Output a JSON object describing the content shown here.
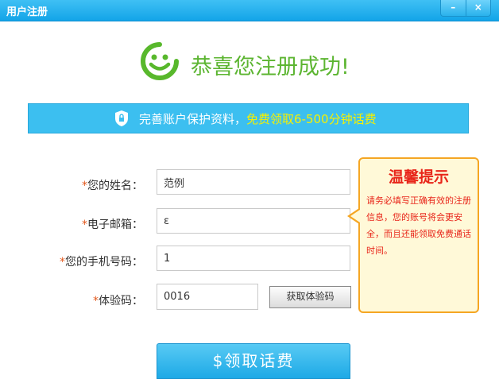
{
  "window": {
    "title": "用户注册",
    "minimize": "–",
    "close": "×"
  },
  "success": {
    "message": "恭喜您注册成功!"
  },
  "banner": {
    "text": "完善账户保护资料，",
    "highlight": "免费领取6-500分钟话费"
  },
  "form": {
    "required_mark": "*",
    "name_label": "您的姓名：",
    "name_value": "范例",
    "email_label": "电子邮箱：",
    "email_value": "ε",
    "phone_label": "您的手机号码：",
    "phone_value": "1",
    "code_label": "体验码：",
    "code_value": "0016",
    "get_code_button": "获取体验码"
  },
  "tip": {
    "title": "温馨提示",
    "body": "请务必填写正确有效的注册信息，您的账号将会更安全，而且还能领取免费通话时间。"
  },
  "claim_button": "$领取话费",
  "colors": {
    "accent": "#3cbff0",
    "success": "#5cb531",
    "warning": "#e8261a",
    "highlight": "#f7f000"
  }
}
